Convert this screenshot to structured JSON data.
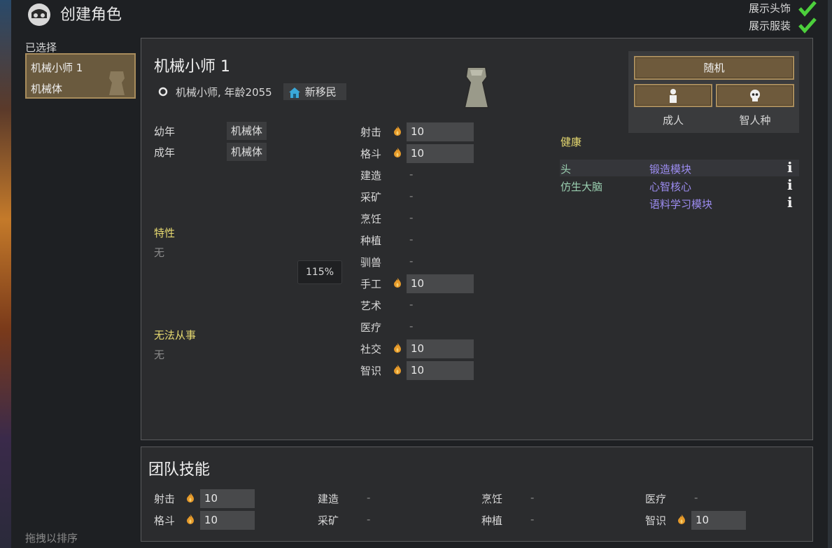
{
  "header": {
    "title": "创建角色",
    "show_headgear": "展示头饰",
    "show_apparel": "展示服装"
  },
  "sidebar": {
    "selected_label": "已选择",
    "pawn_name": "机械小师 1",
    "pawn_type": "机械体",
    "drag_hint": "拖拽以排序"
  },
  "pawn": {
    "name": "机械小师 1",
    "desc": "机械小师, 年龄2055",
    "faction": "新移民",
    "childhood_label": "幼年",
    "childhood_value": "机械体",
    "adulthood_label": "成年",
    "adulthood_value": "机械体",
    "traits_label": "特性",
    "traits_value": "无",
    "incapable_label": "无法从事",
    "incapable_value": "无",
    "percent": "115%"
  },
  "controls": {
    "random": "随机",
    "adult": "成人",
    "xenotype": "智人种"
  },
  "health": {
    "label": "健康",
    "rows": [
      {
        "part": "头",
        "item": "锻造模块"
      },
      {
        "part": "仿生大脑",
        "item": "心智核心"
      },
      {
        "part": "",
        "item": "语料学习模块"
      }
    ]
  },
  "skills": [
    {
      "name": "射击",
      "value": "10",
      "passion": true
    },
    {
      "name": "格斗",
      "value": "10",
      "passion": true
    },
    {
      "name": "建造",
      "value": "-",
      "passion": false
    },
    {
      "name": "采矿",
      "value": "-",
      "passion": false
    },
    {
      "name": "烹饪",
      "value": "-",
      "passion": false
    },
    {
      "name": "种植",
      "value": "-",
      "passion": false
    },
    {
      "name": "驯兽",
      "value": "-",
      "passion": false
    },
    {
      "name": "手工",
      "value": "10",
      "passion": true
    },
    {
      "name": "艺术",
      "value": "-",
      "passion": false
    },
    {
      "name": "医疗",
      "value": "-",
      "passion": false
    },
    {
      "name": "社交",
      "value": "10",
      "passion": true
    },
    {
      "name": "智识",
      "value": "10",
      "passion": true
    }
  ],
  "team": {
    "title": "团队技能",
    "skills": [
      {
        "name": "射击",
        "value": "10",
        "passion": true
      },
      {
        "name": "格斗",
        "value": "10",
        "passion": true
      },
      {
        "name": "建造",
        "value": "-",
        "passion": false
      },
      {
        "name": "采矿",
        "value": "-",
        "passion": false
      },
      {
        "name": "烹饪",
        "value": "-",
        "passion": false
      },
      {
        "name": "种植",
        "value": "-",
        "passion": false
      },
      {
        "name": "医疗",
        "value": "-",
        "passion": false
      },
      {
        "name": "智识",
        "value": "10",
        "passion": true
      }
    ]
  },
  "icons": {
    "passion": "flame-icon",
    "check": "checkmark-icon",
    "home": "home-icon",
    "info": "info-icon"
  }
}
